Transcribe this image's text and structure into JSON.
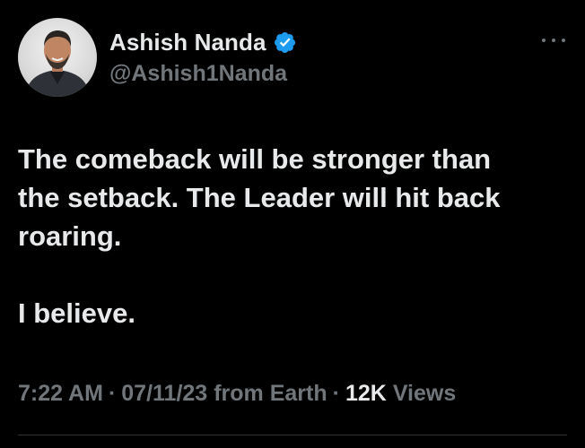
{
  "author": {
    "display_name": "Ashish Nanda",
    "handle": "@Ashish1Nanda",
    "verified_icon": "verified-badge-icon",
    "verified_color": "#1d9bf0"
  },
  "more_icon": "more-horizontal-icon",
  "tweet": {
    "lines": [
      "The comeback will be stronger than",
      "the setback. The Leader will hit back",
      "roaring."
    ],
    "closing": "I believe."
  },
  "meta": {
    "time": "7:22 AM",
    "separator": "·",
    "date": "07/11/23",
    "source": "from Earth",
    "views_count": "12K",
    "views_label": "Views"
  },
  "colors": {
    "background": "#000000",
    "primary_text": "#e7e9ea",
    "secondary_text": "#71767b",
    "accent": "#1d9bf0"
  }
}
